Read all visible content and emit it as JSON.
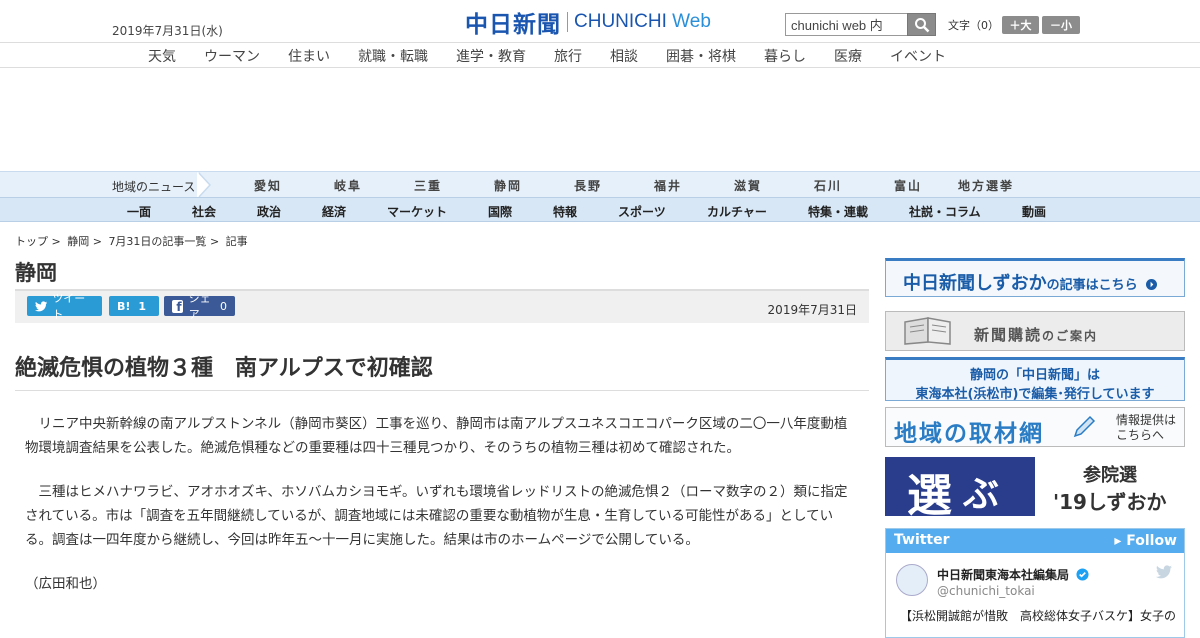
{
  "header": {
    "date": "2019年7月31日(水)",
    "logo_jp": "中日新聞",
    "logo_en": "CHUNICHI",
    "logo_web": "Web",
    "search_value": "chunichi web 内",
    "fontsize_label": "文字（0）",
    "fontsize_plus": "＋大",
    "fontsize_minus": "－小"
  },
  "topnav": [
    "天気",
    "ウーマン",
    "住まい",
    "就職・転職",
    "進学・教育",
    "旅行",
    "相談",
    "囲碁・将棋",
    "暮らし",
    "医療",
    "イベント"
  ],
  "regionbar": {
    "label": "地域のニュース",
    "items": [
      "愛知",
      "岐阜",
      "三重",
      "静岡",
      "長野",
      "福井",
      "滋賀",
      "石川",
      "富山",
      "地方選挙"
    ]
  },
  "sectionbar": [
    "一面",
    "社会",
    "政治",
    "経済",
    "マーケット",
    "国際",
    "特報",
    "スポーツ",
    "カルチャー",
    "特集・連載",
    "社説・コラム",
    "動画"
  ],
  "breadcrumb": [
    "トップ",
    ">",
    "静岡",
    ">",
    "7月31日の記事一覧",
    ">",
    "記事"
  ],
  "article": {
    "prefecture": "静岡",
    "tweet_label": "ツイート",
    "hatena_label": "B!",
    "hatena_count": "1",
    "share_label": "シェア",
    "share_count": "0",
    "date": "2019年7月31日",
    "headline": "絶滅危惧の植物３種　南アルプスで初確認",
    "para1": "　リニア中央新幹線の南アルプストンネル（静岡市葵区）工事を巡り、静岡市は南アルプスユネスコエコパーク区域の二〇一八年度動植物環境調査結果を公表した。絶滅危惧種などの重要種は四十三種見つかり、そのうちの植物三種は初めて確認された。",
    "para2": "　三種はヒメハナワラビ、アオホオズキ、ホソバムカシヨモギ。いずれも環境省レッドリストの絶滅危惧２（ローマ数字の２）類に指定されている。市は「調査を五年間継続しているが、調査地域には未確認の重要な動植物が生息・生育している可能性がある」としている。調査は一四年度から継続し、今回は昨年五～十一月に実施した。結果は市のホームページで公開している。",
    "para3": "（広田和也）"
  },
  "sidebar": {
    "banner1_main": "中日新聞しずおか",
    "banner1_sub": "の記事はこちら",
    "banner2_main": "新聞購読",
    "banner2_sub": "のご案内",
    "banner3_line1": "静岡の「中日新聞」は",
    "banner3_line2": "東海本社(浜松市)で編集･発行しています",
    "banner4_main": "地域の取材網",
    "banner4_sub1": "情報提供は",
    "banner4_sub2": "こちらへ",
    "banner5_kanji1": "選",
    "banner5_kanji2": "ぶ",
    "banner5_r1": "参院選",
    "banner5_r2": "'19しずおか"
  },
  "twitter": {
    "title": "Twitter",
    "follow": "▸ Follow",
    "name": "中日新聞東海本社編集局",
    "handle": "@chunichi_tokai",
    "text": "【浜松開誠館が惜敗　高校総体女子バスケ】女子の"
  },
  "colors": {
    "brand": "#1a56b0",
    "twitter": "#55acee",
    "facebook": "#3a5996",
    "nav_bg": "#d7e7f6"
  }
}
